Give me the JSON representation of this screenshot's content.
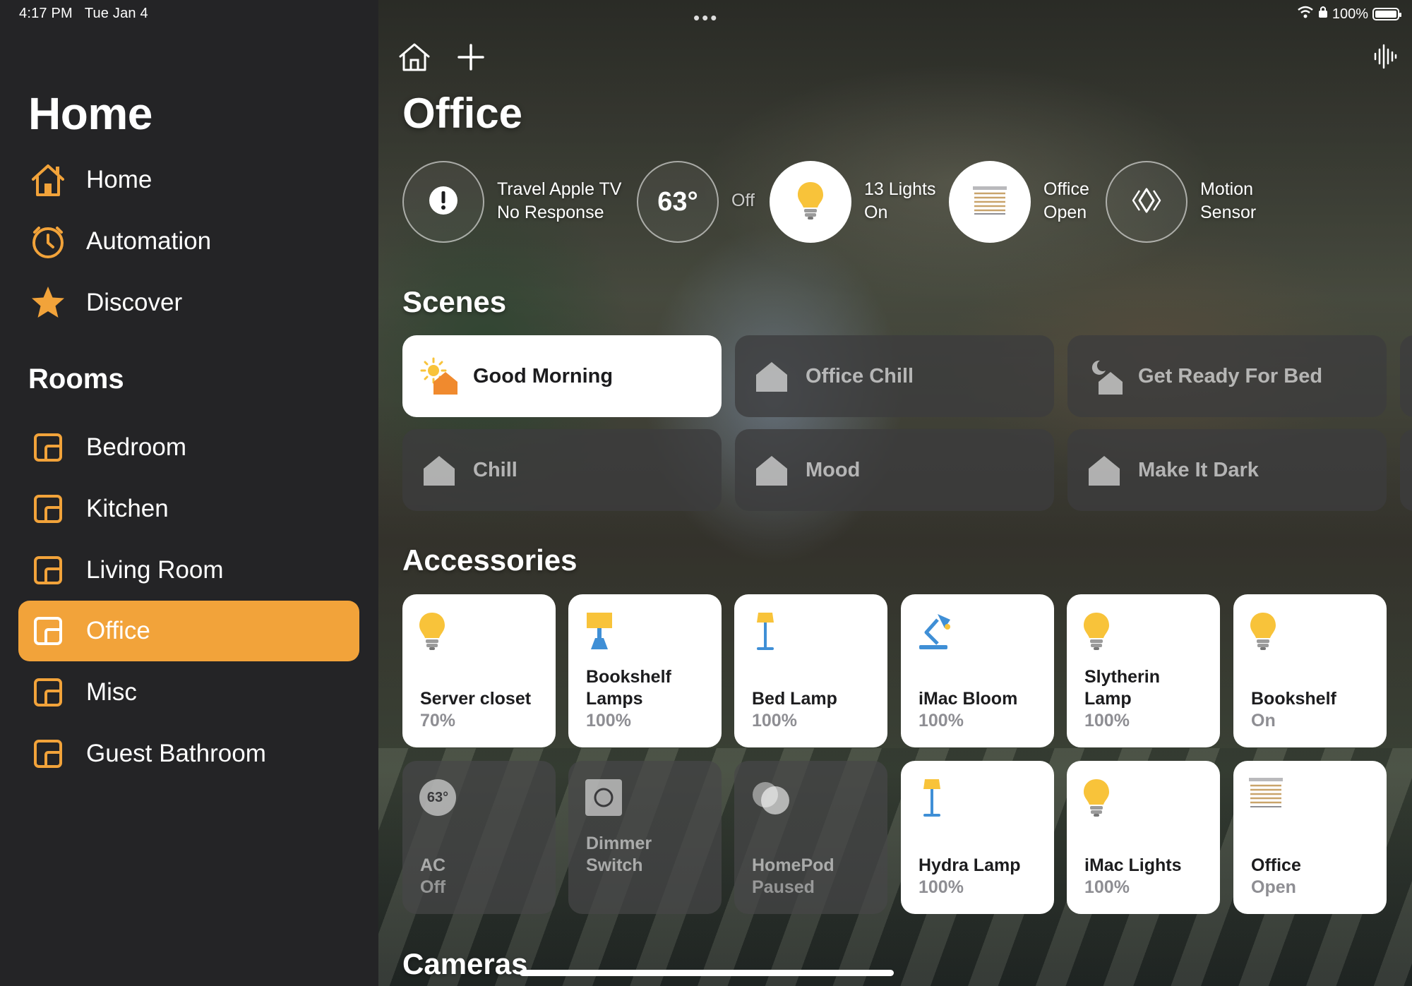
{
  "status_bar": {
    "time": "4:17 PM",
    "date": "Tue Jan 4",
    "battery": "100%"
  },
  "sidebar": {
    "title": "Home",
    "nav": [
      {
        "label": "Home",
        "icon": "house-icon"
      },
      {
        "label": "Automation",
        "icon": "clock-icon"
      },
      {
        "label": "Discover",
        "icon": "star-icon"
      }
    ],
    "rooms_heading": "Rooms",
    "rooms": [
      {
        "label": "Bedroom"
      },
      {
        "label": "Kitchen"
      },
      {
        "label": "Living Room"
      },
      {
        "label": "Office",
        "selected": true
      },
      {
        "label": "Misc"
      },
      {
        "label": "Guest Bathroom"
      }
    ]
  },
  "main": {
    "title": "Office",
    "multitask_dots": "•••",
    "status_items": [
      {
        "icon": "alert-icon",
        "line1": "Travel Apple TV",
        "line2": "No Response"
      },
      {
        "icon": "temperature-icon",
        "value": "63°",
        "line1": "Off",
        "line2": ""
      },
      {
        "icon": "lightbulb-icon",
        "line1": "13 Lights",
        "line2": "On"
      },
      {
        "icon": "blinds-icon",
        "line1": "Office",
        "line2": "Open"
      },
      {
        "icon": "motion-sensor-icon",
        "line1": "Motion",
        "line2": "Sensor"
      }
    ],
    "scenes_title": "Scenes",
    "scenes": [
      {
        "label": "Good Morning",
        "active": true,
        "icon": "sunrise-house-icon"
      },
      {
        "label": "Office Chill",
        "active": false,
        "icon": "house-icon"
      },
      {
        "label": "Get Ready For Bed",
        "active": false,
        "icon": "moon-house-icon"
      },
      {
        "label": "Chill",
        "active": false,
        "icon": "house-icon"
      },
      {
        "label": "Mood",
        "active": false,
        "icon": "house-icon"
      },
      {
        "label": "Make It Dark",
        "active": false,
        "icon": "house-icon"
      }
    ],
    "accessories_title": "Accessories",
    "accessories": [
      {
        "name": "Server closet",
        "state": "70%",
        "on": true,
        "icon": "lightbulb-icon"
      },
      {
        "name": "Bookshelf Lamps",
        "state": "100%",
        "on": true,
        "icon": "table-lamp-icon"
      },
      {
        "name": "Bed Lamp",
        "state": "100%",
        "on": true,
        "icon": "floor-lamp-icon"
      },
      {
        "name": "iMac Bloom",
        "state": "100%",
        "on": true,
        "icon": "desk-lamp-icon"
      },
      {
        "name": "Slytherin Lamp",
        "state": "100%",
        "on": true,
        "icon": "lightbulb-icon"
      },
      {
        "name": "Bookshelf",
        "state": "On",
        "on": true,
        "icon": "lightbulb-icon"
      },
      {
        "name": "AC",
        "state": "Off",
        "on": false,
        "icon": "thermostat-icon",
        "value": "63°"
      },
      {
        "name": "Dimmer Switch",
        "state": "",
        "on": false,
        "icon": "switch-icon"
      },
      {
        "name": "HomePod",
        "state": "Paused",
        "on": false,
        "icon": "homepod-icon"
      },
      {
        "name": "Hydra Lamp",
        "state": "100%",
        "on": true,
        "icon": "floor-lamp-icon"
      },
      {
        "name": "iMac Lights",
        "state": "100%",
        "on": true,
        "icon": "lightbulb-icon"
      },
      {
        "name": "Office",
        "state": "Open",
        "on": true,
        "icon": "blinds-icon"
      }
    ],
    "cameras_title": "Cameras"
  },
  "colors": {
    "accent": "#f2a33a",
    "bulb": "#f8c33a",
    "sidebar": "#242426",
    "lamp_blue": "#3f8fd6"
  }
}
